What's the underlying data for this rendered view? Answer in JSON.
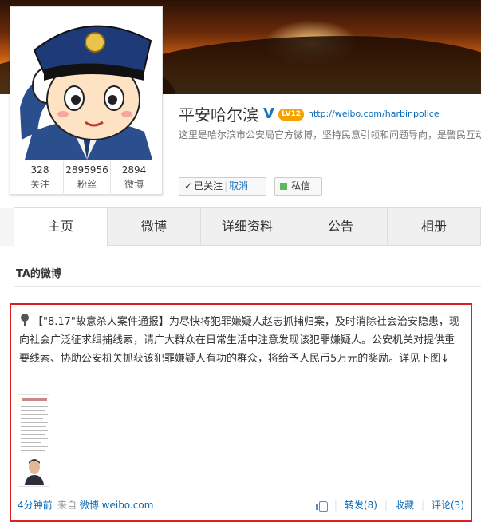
{
  "profile": {
    "name": "平安哈尔滨",
    "verified_icon": "verified-v-icon",
    "verified_symbol": "V",
    "level": "LV12",
    "url": "http://weibo.com/harbinpolice",
    "intro": "这里是哈尔滨市公安局官方微博，坚持民意引领和问题导向，是警民互动",
    "stats": [
      {
        "value": "328",
        "label": "关注"
      },
      {
        "value": "2895956",
        "label": "粉丝"
      },
      {
        "value": "2894",
        "label": "微博"
      }
    ]
  },
  "buttons": {
    "followed": "已关注",
    "cancel": "取消",
    "message": "私信"
  },
  "tabs": [
    "主页",
    "微博",
    "详细资料",
    "公告",
    "相册"
  ],
  "section_title": "TA的微博",
  "post": {
    "text": "【\"8.17\"故意杀人案件通报】为尽快将犯罪嫌疑人赵志抓捕归案，及时消除社会治安隐患，现向社会广泛征求缉捕线索，请广大群众在日常生活中注意发现该犯罪嫌疑人。公安机关对提供重要线索、协助公安机关抓获该犯罪嫌疑人有功的群众，将给予人民币5万元的奖励。详见下图↓",
    "time": "4分钟前",
    "from_prefix": "来自",
    "from_link": "微博 weibo.com",
    "repost": "转发(8)",
    "favorite": "收藏",
    "comment": "评论(3)"
  },
  "colors": {
    "highlight_border": "#e02020",
    "link": "#0a6ab8",
    "level_badge": "#f5a200",
    "message_square": "#5cb85c"
  }
}
